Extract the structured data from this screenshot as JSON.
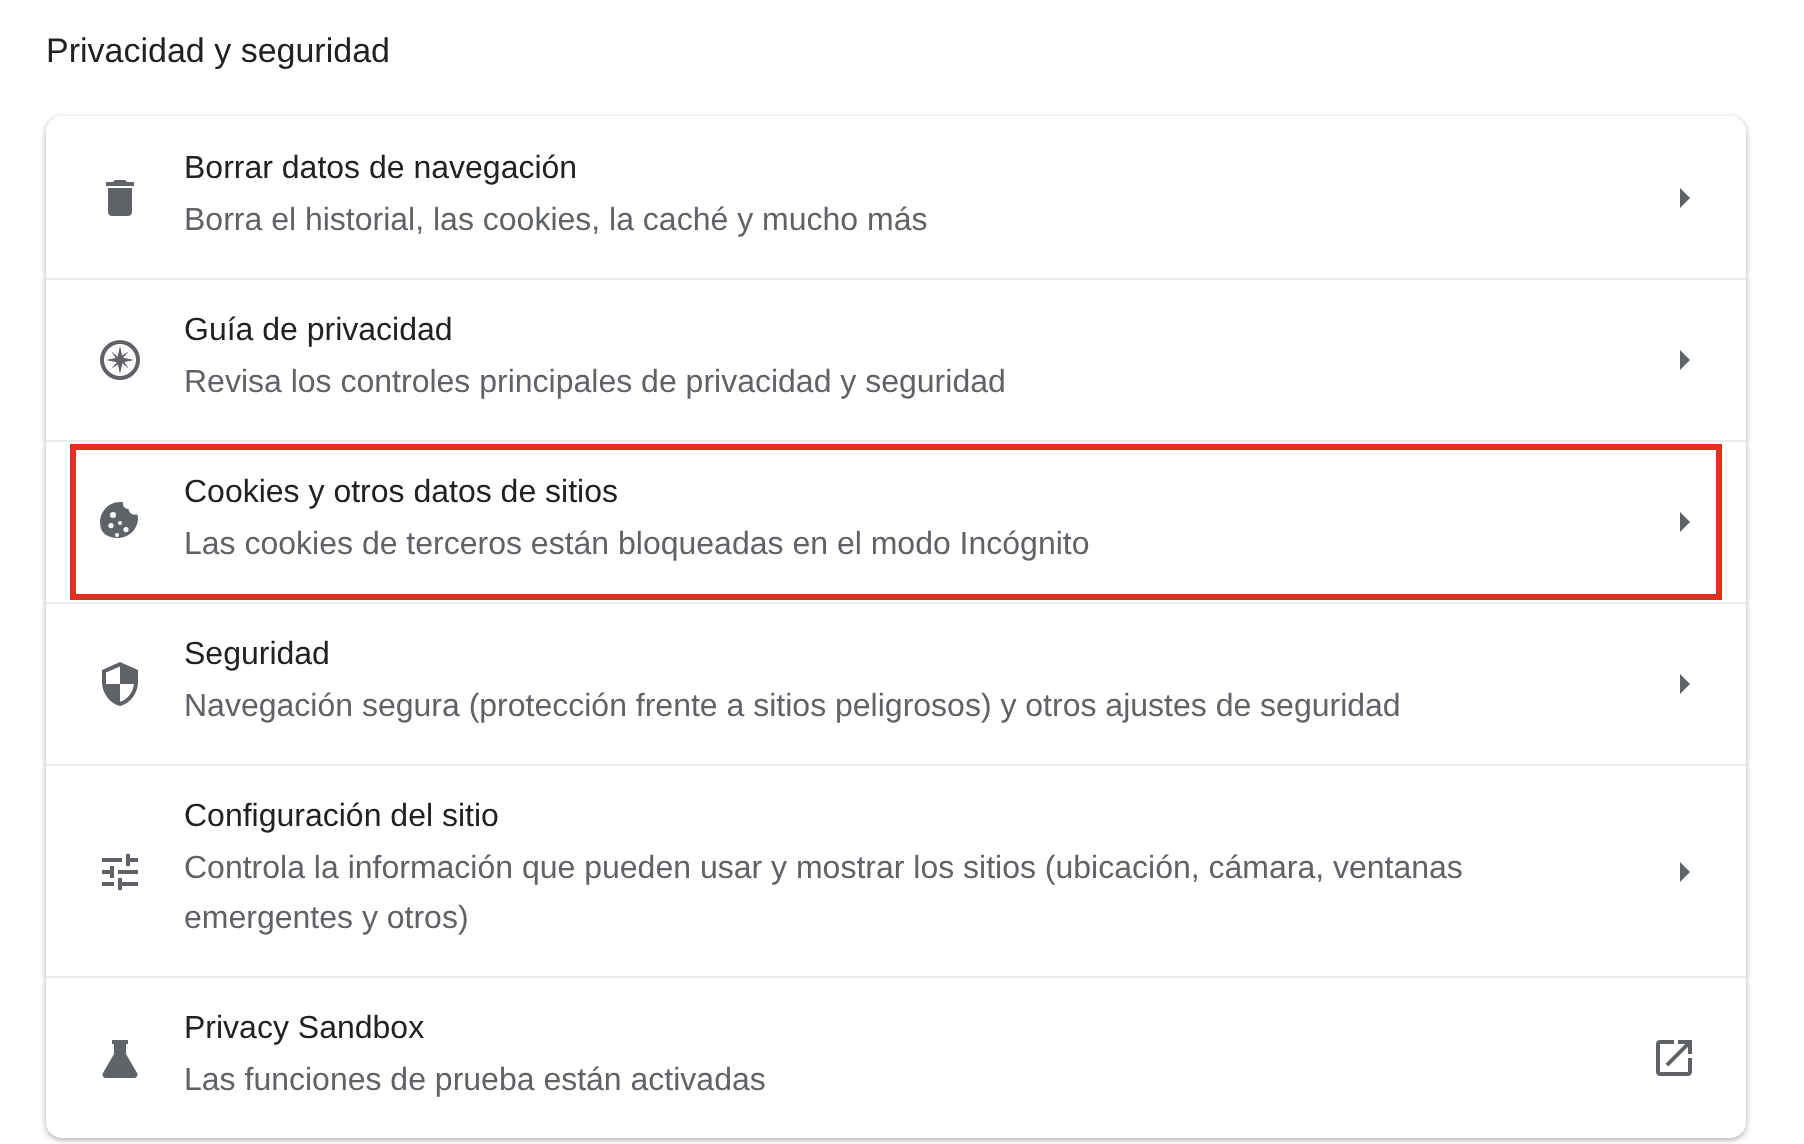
{
  "section_title": "Privacidad y seguridad",
  "items": [
    {
      "kind": "trash",
      "title": "Borrar datos de navegación",
      "subtitle": "Borra el historial, las cookies, la caché y mucho más",
      "external_link": false,
      "highlighted": false
    },
    {
      "kind": "compass",
      "title": "Guía de privacidad",
      "subtitle": "Revisa los controles principales de privacidad y seguridad",
      "external_link": false,
      "highlighted": false
    },
    {
      "kind": "cookie",
      "title": "Cookies y otros datos de sitios",
      "subtitle": "Las cookies de terceros están bloqueadas en el modo Incógnito",
      "external_link": false,
      "highlighted": true
    },
    {
      "kind": "shield",
      "title": "Seguridad",
      "subtitle": "Navegación segura (protección frente a sitios peligrosos) y otros ajustes de seguridad",
      "external_link": false,
      "highlighted": false
    },
    {
      "kind": "sliders",
      "title": "Configuración del sitio",
      "subtitle": "Controla la información que pueden usar y mostrar los sitios (ubicación, cámara, ventanas emergentes y otros)",
      "external_link": false,
      "highlighted": false
    },
    {
      "kind": "flask",
      "title": "Privacy Sandbox",
      "subtitle": "Las funciones de prueba están activadas",
      "external_link": true,
      "highlighted": false
    }
  ]
}
